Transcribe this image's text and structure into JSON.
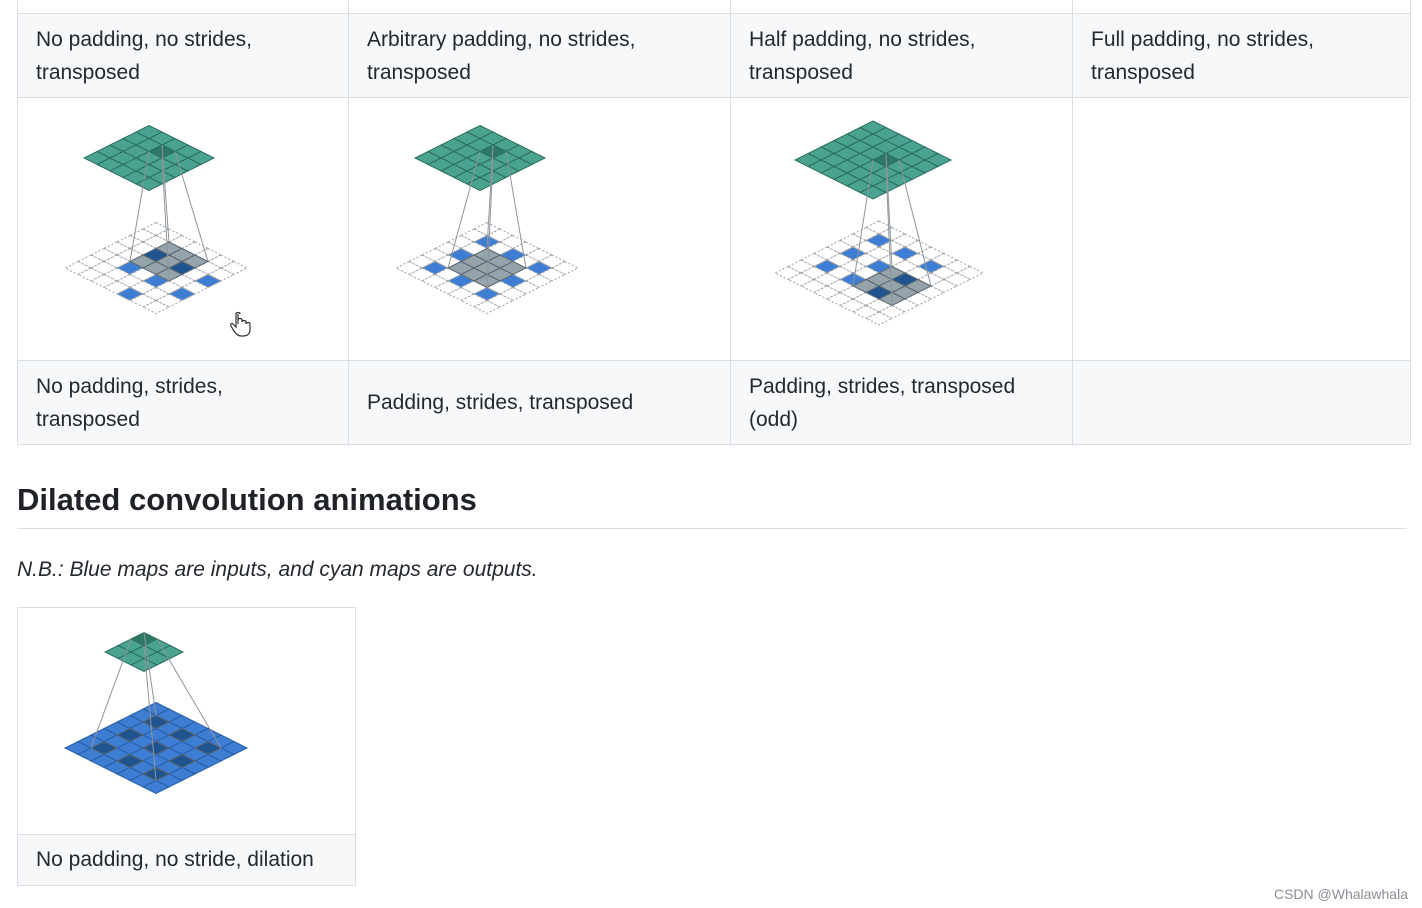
{
  "transposed_table": {
    "row1_captions": [
      "No padding, no strides, transposed",
      "Arbitrary padding, no strides, transposed",
      "Half padding, no strides, transposed",
      "Full padding, no strides, transposed"
    ],
    "row2_captions": [
      "No padding, strides, transposed",
      "Padding, strides, transposed",
      "Padding, strides, transposed (odd)",
      ""
    ]
  },
  "section": {
    "heading": "Dilated convolution animations",
    "note": "N.B.: Blue maps are inputs, and cyan maps are outputs."
  },
  "dilated_table": {
    "caption": "No padding, no stride, dilation"
  },
  "watermark": "CSDN @Whalawhala",
  "colors": {
    "output_cyan": "#4aa391",
    "input_blue": "#3d7ed4",
    "kernel_gray": "#95a3ab",
    "dark_blue": "#1f5490",
    "border": "#d8dee4",
    "header_bg": "#f6f8fa"
  }
}
